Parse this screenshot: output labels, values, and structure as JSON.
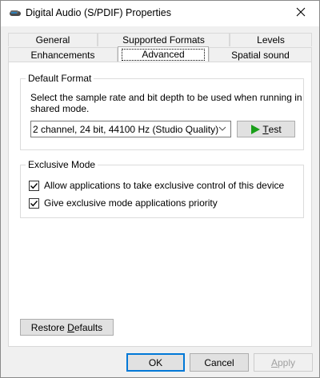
{
  "window": {
    "title": "Digital Audio (S/PDIF) Properties",
    "title_icon": "speaker-icon",
    "close_icon": "close-icon"
  },
  "tabs": {
    "row1": [
      "General",
      "Supported Formats",
      "Levels"
    ],
    "row2": [
      "Enhancements",
      "Advanced",
      "Spatial sound"
    ],
    "active": "Advanced"
  },
  "default_format": {
    "label": "Default Format",
    "description": "Select the sample rate and bit depth to be used when running in shared mode.",
    "selected_format": "2 channel, 24 bit, 44100 Hz (Studio Quality)",
    "test_label_prefix": "",
    "test_label_underlined": "T",
    "test_label_rest": "est",
    "test_icon": "play-icon"
  },
  "exclusive_mode": {
    "label": "Exclusive Mode",
    "options": [
      {
        "label": "Allow applications to take exclusive control of this device",
        "checked": true
      },
      {
        "label": "Give exclusive mode applications priority",
        "checked": true
      }
    ]
  },
  "restore_defaults": {
    "prefix": "Restore ",
    "underlined": "D",
    "rest": "efaults"
  },
  "dialog_buttons": {
    "ok": "OK",
    "cancel": "Cancel",
    "apply_underlined": "A",
    "apply_rest": "pply"
  },
  "colors": {
    "accent": "#0078d7",
    "play_green": "#1a9f1a"
  }
}
